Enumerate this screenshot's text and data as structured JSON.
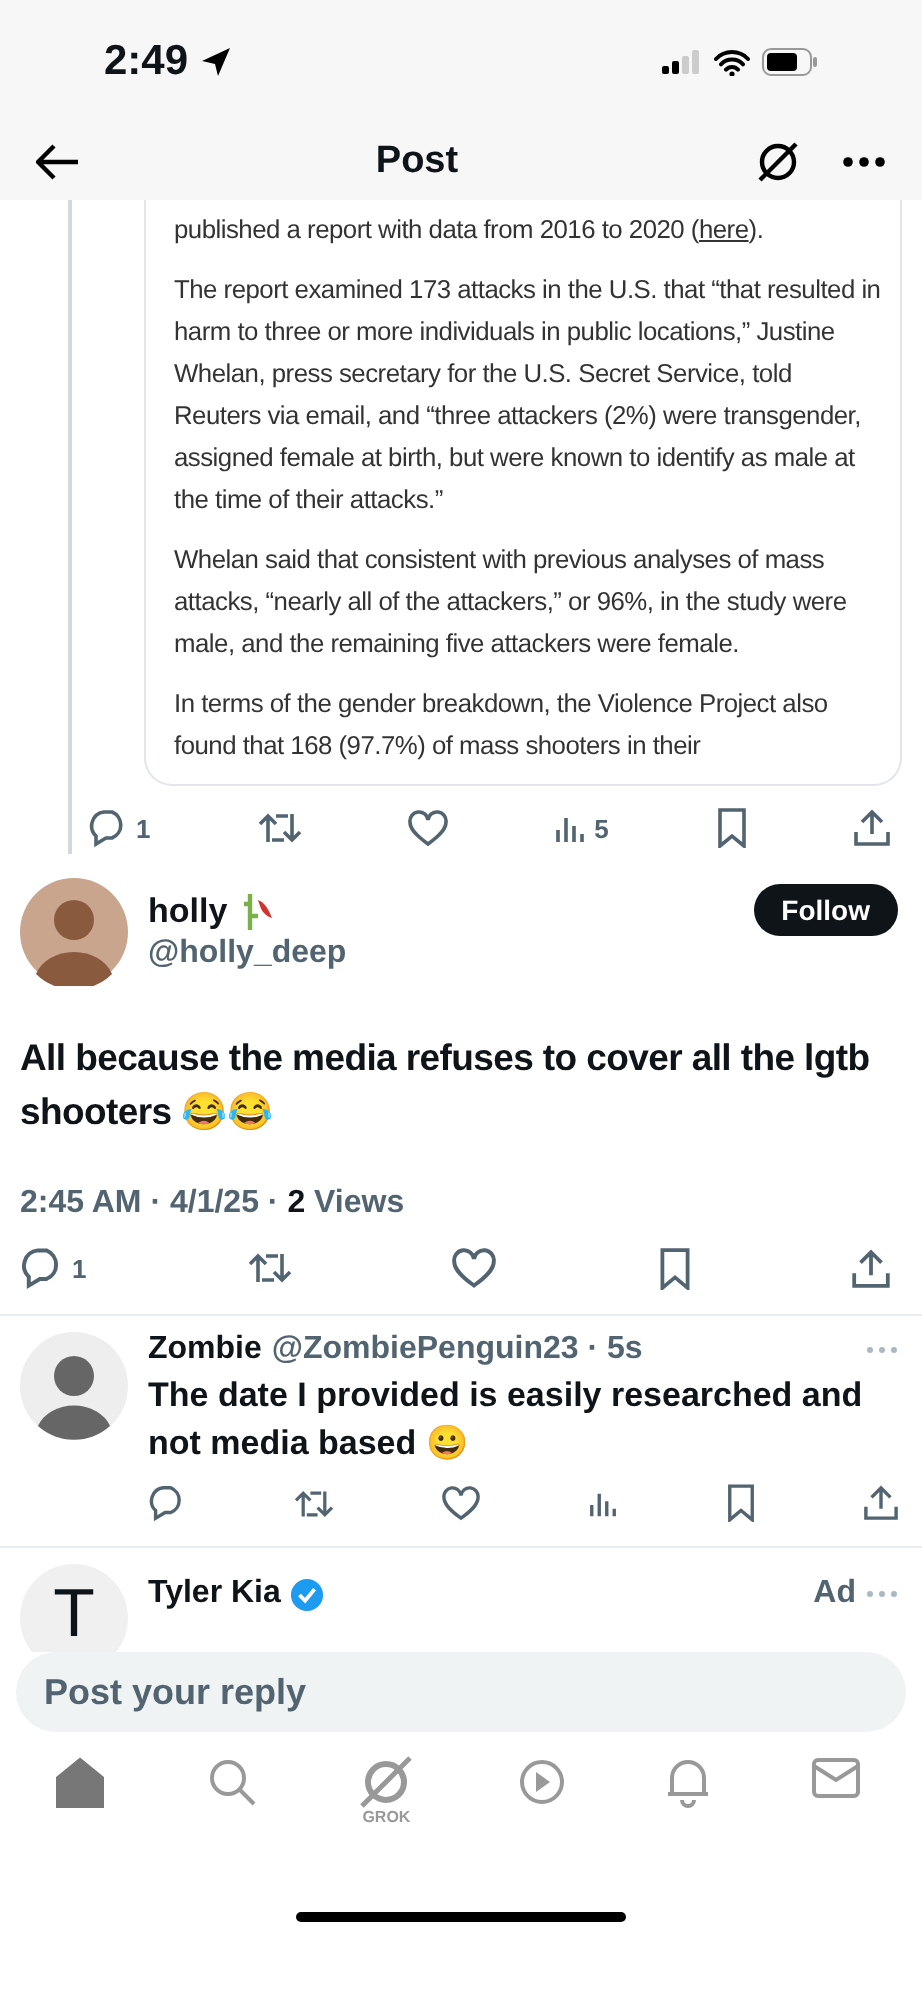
{
  "status_bar": {
    "time": "2:49"
  },
  "header": {
    "title": "Post"
  },
  "quoted_article": {
    "paragraphs": [
      {
        "text": "published a report with data from 2016 to 2020 (",
        "link": "here",
        "after": ")."
      },
      {
        "text": "The report examined 173 attacks in the U.S. that “that resulted in harm to three or more individuals in public locations,” Justine Whelan, press secretary for the U.S. Secret Service, told Reuters via email, and “three attackers (2%) were transgender, assigned female at birth, but were known to identify as male at the time of their attacks.”"
      },
      {
        "text": "Whelan said that consistent with previous analyses of mass attacks, “nearly all of the attackers,” or 96%, in the study were male, and the remaining five attackers were female."
      },
      {
        "text": "In terms of the gender breakdown, the Violence Project also found that 168 (97.7%) of mass shooters in their"
      }
    ]
  },
  "quoted_actions": [
    {
      "kind": "reply",
      "count": "1"
    },
    {
      "kind": "repost"
    },
    {
      "kind": "like"
    },
    {
      "kind": "views",
      "count": "5"
    },
    {
      "kind": "bookmark"
    },
    {
      "kind": "share"
    }
  ],
  "post": {
    "name": "holly",
    "handle": "@holly_deep",
    "follow": "Follow",
    "text": "All because the media refuses to cover all the lgtb shooters 😂😂",
    "meta": "2:45 AM · 4/1/25 · **2** Views",
    "actions": [
      {
        "kind": "reply",
        "count": "1"
      },
      {
        "kind": "repost"
      },
      {
        "kind": "like"
      },
      {
        "kind": "bookmark"
      },
      {
        "kind": "share"
      }
    ]
  },
  "replies": [
    {
      "kind": "reply",
      "name": "Zombie",
      "handle": "@ZombiePenguin23 · 5s",
      "text": "The date I provided is easily researched and not media based 😀",
      "actions": [
        {
          "kind": "reply"
        },
        {
          "kind": "repost"
        },
        {
          "kind": "like"
        },
        {
          "kind": "views"
        },
        {
          "kind": "bookmark"
        },
        {
          "kind": "share"
        }
      ]
    },
    {
      "kind": "ad",
      "avatar_letter": "T",
      "name": "Tyler Kia",
      "verified": true,
      "ad_label": "Ad"
    }
  ],
  "reply_bar": {
    "placeholder": "Post your reply"
  },
  "tab_bar": [
    {
      "kind": "home",
      "selected": true
    },
    {
      "kind": "search",
      "selected": false
    },
    {
      "kind": "grok",
      "label": "GROK",
      "selected": false
    },
    {
      "kind": "video",
      "selected": false
    },
    {
      "kind": "bell",
      "selected": false
    },
    {
      "kind": "mail",
      "selected": false
    }
  ]
}
